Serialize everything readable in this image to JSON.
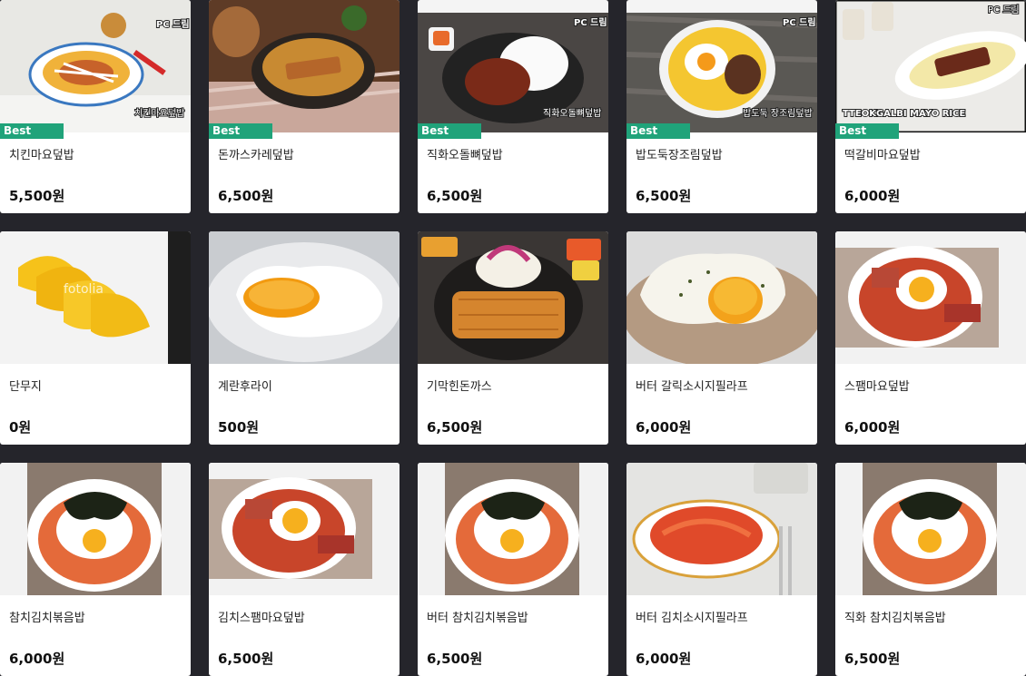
{
  "menu": {
    "items": [
      {
        "name": "치킨마요덮밥",
        "price": "5,500원",
        "badge": "Best",
        "photo_caption": "치킨마요덮밥",
        "brand_mark": "PC 드림"
      },
      {
        "name": "돈까스카레덮밥",
        "price": "6,500원",
        "badge": "Best"
      },
      {
        "name": "직화오돌뼈덮밥",
        "price": "6,500원",
        "badge": "Best",
        "photo_caption": "직화오돌뼈덮밥",
        "brand_mark": "PC 드림"
      },
      {
        "name": "밥도둑장조림덮밥",
        "price": "6,500원",
        "badge": "Best",
        "photo_caption": "밥도둑 장조림덮밥",
        "brand_mark": "PC 드림"
      },
      {
        "name": "떡갈비마요덮밥",
        "price": "6,000원",
        "badge": "Best",
        "photo_caption": "TTEOKGALBI MAYO RICE",
        "brand_mark": "PC 드림"
      },
      {
        "name": "단무지",
        "price": "0원",
        "watermark": "fotolia"
      },
      {
        "name": "계란후라이",
        "price": "500원"
      },
      {
        "name": "기막힌돈까스",
        "price": "6,500원"
      },
      {
        "name": "버터 갈릭소시지필라프",
        "price": "6,000원"
      },
      {
        "name": "스팸마요덮밥",
        "price": "6,000원"
      },
      {
        "name": "참치김치볶음밥",
        "price": "6,000원"
      },
      {
        "name": "김치스팸마요덮밥",
        "price": "6,500원"
      },
      {
        "name": "버터 참치김치볶음밥",
        "price": "6,500원"
      },
      {
        "name": "버터 김치소시지필라프",
        "price": "6,000원"
      },
      {
        "name": "직화 참치김치볶음밥",
        "price": "6,500원"
      }
    ]
  },
  "colors": {
    "page_background": "#25252b",
    "card_background": "#ffffff",
    "best_badge": "#20a37a"
  }
}
